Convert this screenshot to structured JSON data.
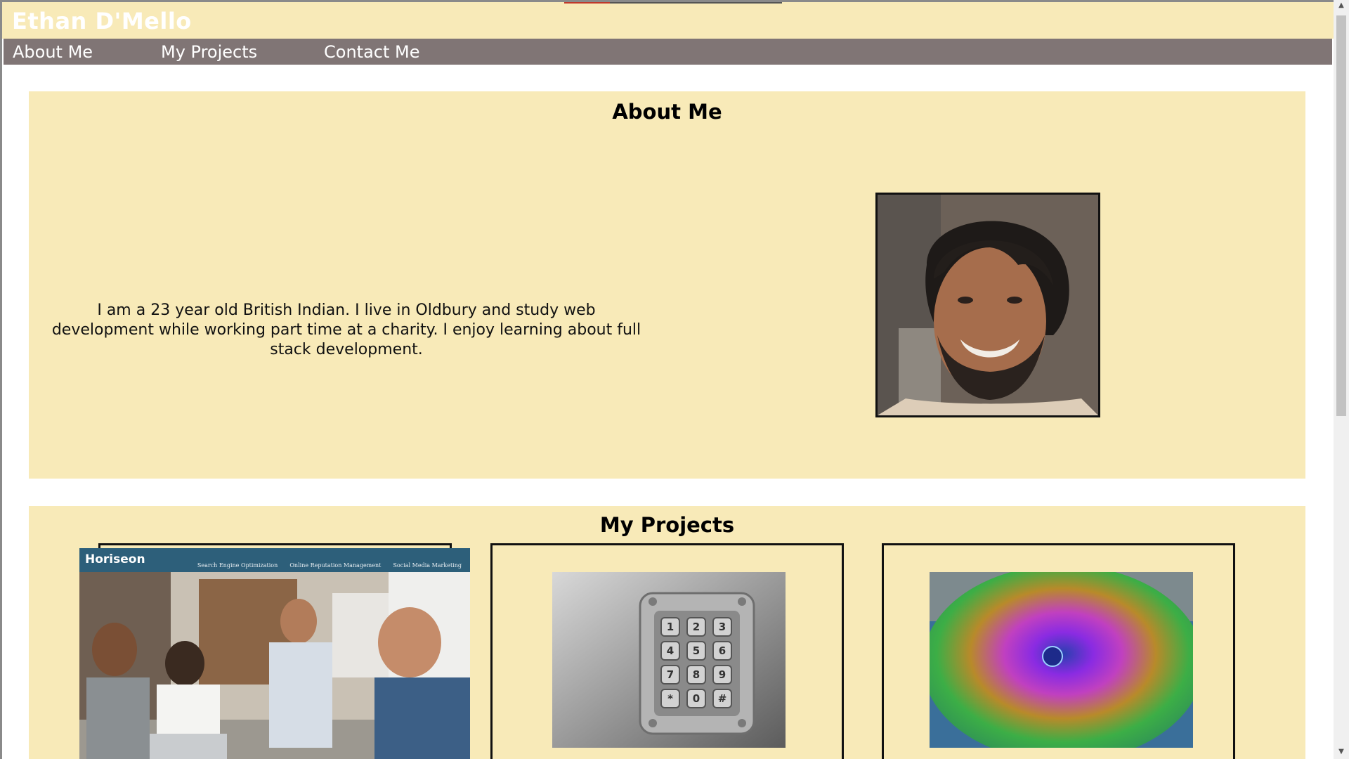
{
  "header": {
    "brand": "Ethan D'Mello"
  },
  "nav": {
    "items": [
      "About Me",
      "My Projects",
      "Contact Me"
    ]
  },
  "about": {
    "title": "About Me",
    "text": "I am a 23 year old British Indian. I live in Oldbury and study web development while working part time at a charity. I enjoy learning about full stack development."
  },
  "projects": {
    "title": "My Projects",
    "horiseon": {
      "logo": "Horiseon",
      "links": [
        "Search Engine Optimization",
        "Online Reputation Management",
        "Social Media Marketing"
      ]
    },
    "keypad_keys": [
      "1",
      "2",
      "3",
      "4",
      "5",
      "6",
      "7",
      "8",
      "9",
      "*",
      "0",
      "#"
    ]
  },
  "colors": {
    "header_bg": "#f8eab8",
    "nav_bg": "#807575",
    "section_bg": "#f8eab8"
  }
}
